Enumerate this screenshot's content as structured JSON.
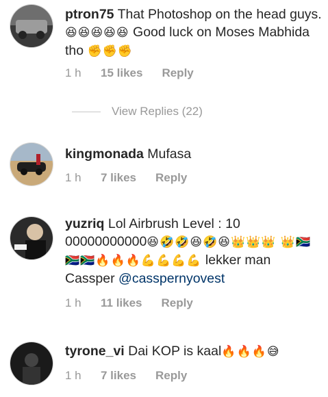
{
  "comments": [
    {
      "username": "ptron75",
      "text": " That Photoshop on the head guys. ",
      "emoji1": "😆😆😆😆😆",
      "text2": " Good luck on Moses Mabhida tho ",
      "emoji2": "✊✊✊",
      "time": "1 h",
      "likes": "15 likes",
      "reply": "Reply",
      "view_replies": "View Replies (22)"
    },
    {
      "username": "kingmonada",
      "text": " Mufasa",
      "time": "1 h",
      "likes": "7 likes",
      "reply": "Reply"
    },
    {
      "username": "yuzriq",
      "text": " Lol Airbrush Level : 10 00000000000",
      "emoji1": "😆🤣🤣😆🤣😆👑👑👑 👑🇿🇦🇿🇦🇿🇦🔥🔥🔥💪💪💪💪",
      "text2": " lekker man Cassper ",
      "mention": "@casspernyovest",
      "time": "1 h",
      "likes": "11 likes",
      "reply": "Reply"
    },
    {
      "username": "tyrone_vi",
      "text": " Dai KOP is kaal",
      "emoji1": "🔥🔥🔥😅",
      "time": "1 h",
      "likes": "7 likes",
      "reply": "Reply"
    }
  ]
}
